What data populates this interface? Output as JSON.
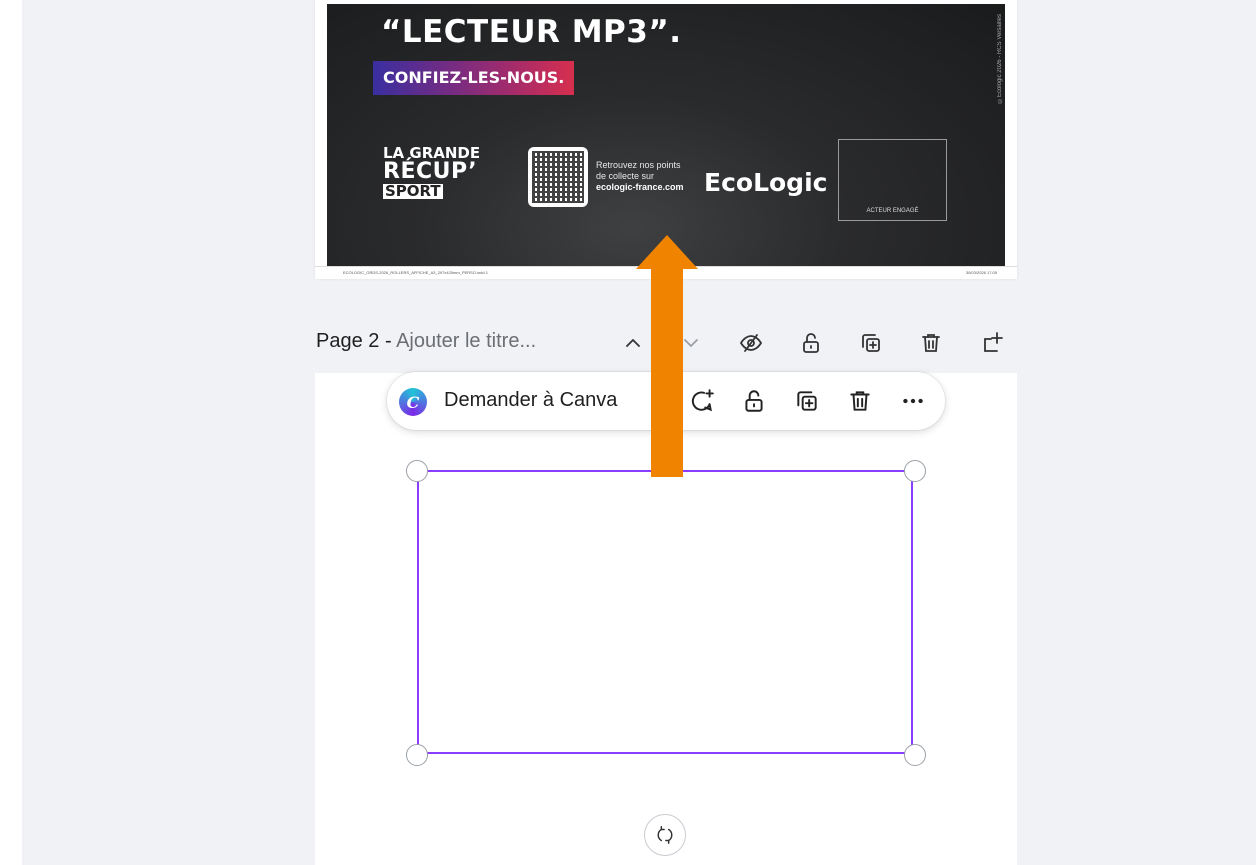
{
  "page1": {
    "headline": "“LECTEUR MP3”.",
    "tagline": "CONFIEZ-LES-NOUS.",
    "side_text": "©Ecologic 2026 - RCS Versailles",
    "logo_line1": "LA GRANDE",
    "logo_line2": "RÉCUP’",
    "logo_line3": "SPORT",
    "retrouvez_line1": "Retrouvez nos points",
    "retrouvez_line2": "de collecte sur",
    "retrouvez_line3": "ecologic-france.com",
    "ecologic_logo": "EcoLogic",
    "acteur_label": "ACTEUR ENGAGÉ",
    "footer_left": "ECOLOGIC_GRDS-2026_ROLLERS_AFFICHE_A3_297x420mm_PERSO.indd 1",
    "footer_right": "30/03/2026   17:05"
  },
  "page2_header": {
    "page_label": "Page 2 - ",
    "title_placeholder": "Ajouter le titre..."
  },
  "toolbar": {
    "ask_label": "Demander à Canva"
  },
  "colors": {
    "selection": "#8b3dff",
    "annotation_arrow": "#f08300",
    "workspace_bg": "#f1f2f6"
  }
}
